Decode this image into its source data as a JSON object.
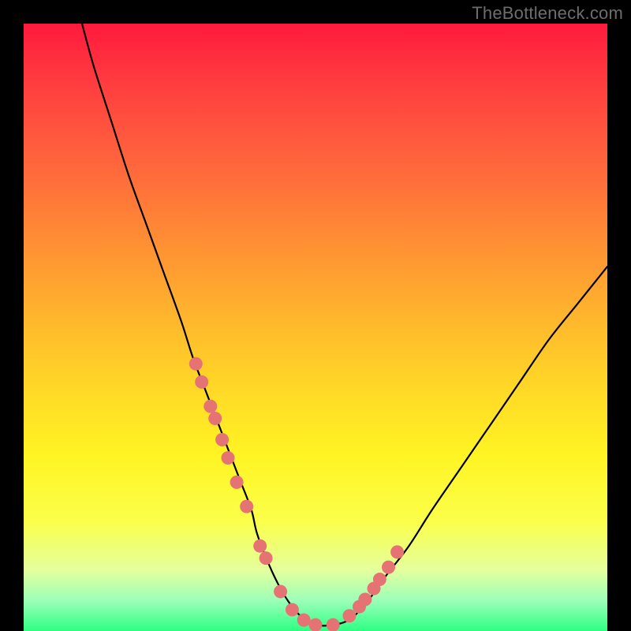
{
  "watermark": "TheBottleneck.com",
  "colors": {
    "frame": "#000000",
    "curve": "#000000",
    "marker_fill": "#e57373",
    "marker_stroke": "#c94f4f"
  },
  "chart_data": {
    "type": "line",
    "title": "",
    "xlabel": "",
    "ylabel": "",
    "xlim": [
      0,
      100
    ],
    "ylim": [
      0,
      100
    ],
    "series": [
      {
        "name": "bottleneck-curve",
        "x": [
          10,
          12,
          15,
          18,
          21,
          24,
          27,
          29,
          31,
          33,
          35,
          37,
          39,
          40,
          42,
          44,
          46,
          48,
          50,
          53,
          56,
          59,
          62,
          66,
          70,
          75,
          80,
          85,
          90,
          95,
          100
        ],
        "y": [
          100,
          93,
          84,
          75,
          67,
          59,
          51,
          45,
          40,
          35,
          30,
          25,
          20,
          16,
          11,
          7,
          4,
          2,
          1,
          1,
          2,
          5,
          9,
          14,
          20,
          27,
          34,
          41,
          48,
          54,
          60
        ]
      }
    ],
    "markers": {
      "name": "highlight-points",
      "x": [
        29.5,
        30.5,
        32,
        32.8,
        34,
        35,
        36.5,
        38.2,
        40.5,
        41.5,
        44,
        46,
        48,
        50,
        53,
        55.8,
        57.5,
        58.5,
        60,
        61,
        62.5,
        64
      ],
      "y": [
        44,
        41,
        37,
        35,
        31.5,
        28.5,
        24.5,
        20.5,
        14,
        12,
        6.5,
        3.5,
        1.8,
        1,
        1,
        2.5,
        4,
        5.2,
        7,
        8.5,
        10.5,
        13
      ]
    }
  }
}
